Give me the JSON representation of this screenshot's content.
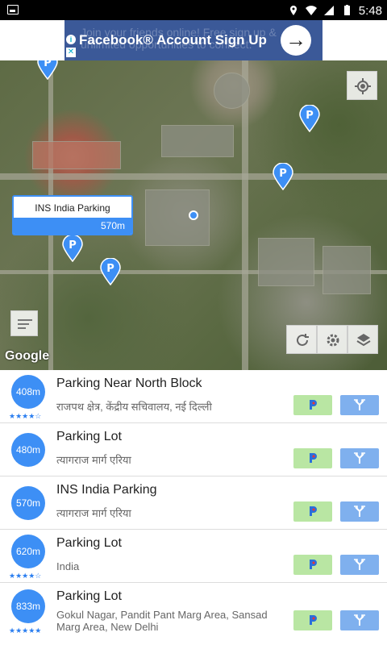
{
  "status_bar": {
    "time": "5:48"
  },
  "ad": {
    "ghost_text": "Join your friends online! Free sign up & unlimited opportunities to connect.",
    "title": "Facebook® Account Sign Up",
    "arrow_icon": "arrow-right-icon"
  },
  "map": {
    "callout": {
      "name": "INS India Parking",
      "distance": "570m"
    },
    "attribution": "Google",
    "colors": {
      "accent": "#3d8ff5",
      "satellite_green": "#5e6b45"
    }
  },
  "list": {
    "items": [
      {
        "distance": "408m",
        "name": "Parking Near North Block",
        "address": "राजपथ क्षेत्र, केंद्रीय सचिवालय, नई दिल्ली",
        "rating": 3.5,
        "stars": "★★★★☆"
      },
      {
        "distance": "480m",
        "name": "Parking Lot",
        "address": "त्यागराज मार्ग एरिया",
        "rating": null,
        "stars": ""
      },
      {
        "distance": "570m",
        "name": "INS India Parking",
        "address": "त्यागराज मार्ग एरिया",
        "rating": null,
        "stars": ""
      },
      {
        "distance": "620m",
        "name": "Parking Lot",
        "address": "India",
        "rating": 4,
        "stars": "★★★★☆"
      },
      {
        "distance": "833m",
        "name": "Parking Lot",
        "address": "Gokul Nagar, Pandit Pant Marg Area, Sansad Marg Area, New Delhi",
        "rating": 5,
        "stars": "★★★★★"
      }
    ]
  }
}
